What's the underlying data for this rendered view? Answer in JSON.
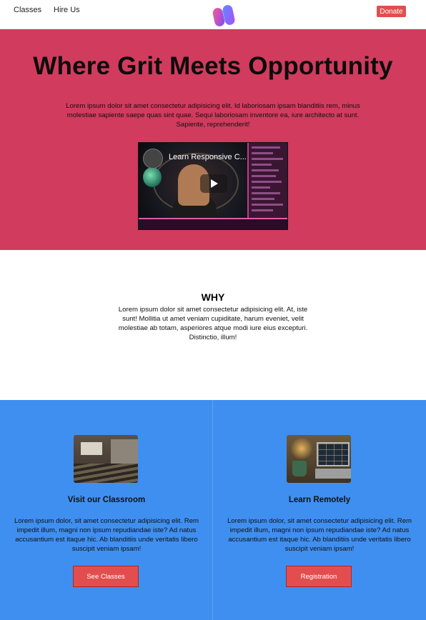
{
  "nav": {
    "links": [
      "Classes",
      "Hire Us"
    ],
    "donate_label": "Donate",
    "logo_icon": "brand-logo-icon"
  },
  "hero": {
    "title": "Where Grit Meets Opportunity",
    "text": "Lorem ipsum dolor sit amet consectetur adipisicing elit. Id laboriosam ipsam blanditiis rem, minus molestiae sapiente saepe quas sint quae. Sequi laboriosam inventore ea, iure architecto at sunt. Sapiente, reprehenderit!",
    "video": {
      "title": "Learn Responsive C...",
      "play_icon": "play-icon"
    }
  },
  "why": {
    "title": "WHY",
    "text": "Lorem ipsum dolor sit amet consectetur adipisicing elit. At, iste sunt! Mollitia ut amet veniam cupiditate, harum eveniet, velit molestiae ab totam, asperiores atque modi iure eius excepturi. Distinctio, illum!"
  },
  "cards": [
    {
      "title": "Visit our Classroom",
      "text": "Lorem ipsum dolor, sit amet consectetur adipisicing elit. Rem impedit illum, magni non ipsum repudiandae iste? Ad natus accusantium est itaque hic. Ab blanditiis unde veritatis libero suscipit veniam ipsam!",
      "button_label": "See Classes"
    },
    {
      "title": "Learn Remotely",
      "text": "Lorem ipsum dolor, sit amet consectetur adipisicing elit. Rem impedit illum, magni non ipsum repudiandae iste? Ad natus accusantium est itaque hic. Ab blanditiis unde veritatis libero suscipit veniam ipsam!",
      "button_label": "Registration"
    }
  ],
  "colors": {
    "hero_bg": "#d13b5d",
    "cards_bg": "#3f8ff0",
    "button_bg": "#e24e4e"
  }
}
